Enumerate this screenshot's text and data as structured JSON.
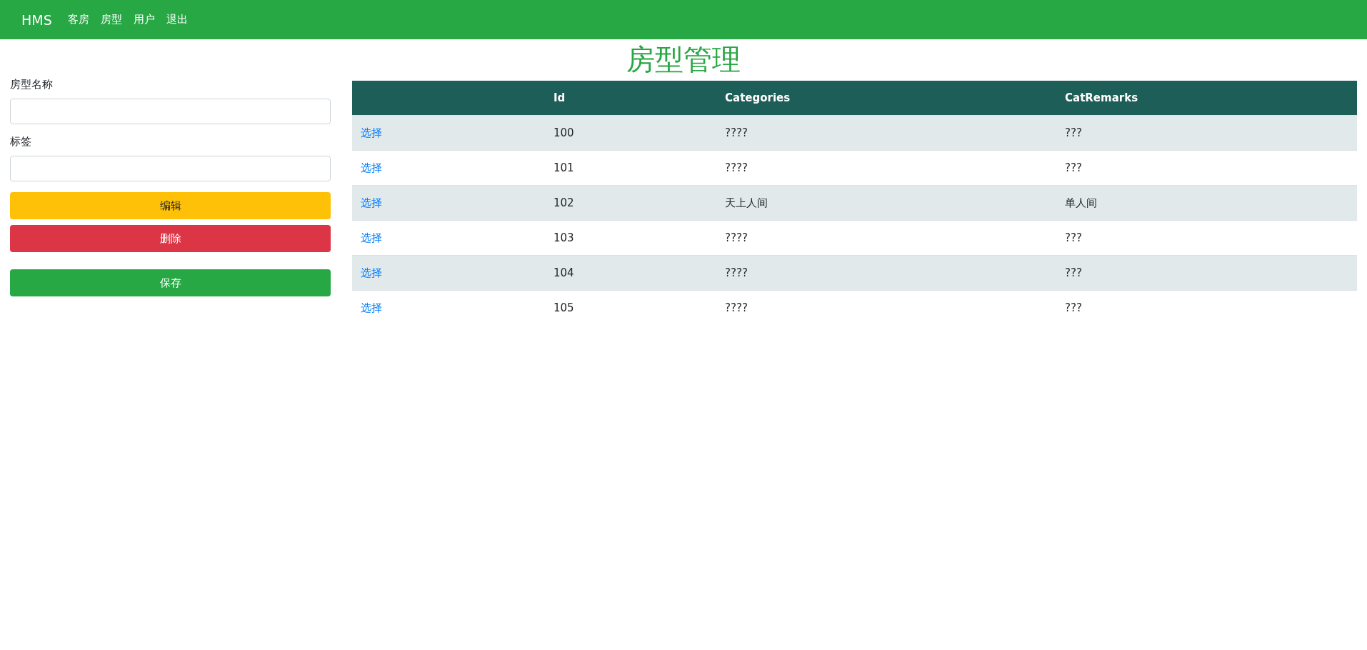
{
  "navbar": {
    "brand": "HMS",
    "links": [
      "客房",
      "房型",
      "用户",
      "退出"
    ]
  },
  "title": "房型管理",
  "form": {
    "fields": [
      {
        "label": "房型名称"
      },
      {
        "label": "标签"
      }
    ],
    "buttons": [
      {
        "label": "编辑",
        "kind": "warning"
      },
      {
        "label": "删除",
        "kind": "danger"
      },
      {
        "label": "保存",
        "kind": "success"
      }
    ]
  },
  "table": {
    "columns": [
      "",
      "Id",
      "Categories",
      "CatRemarks"
    ],
    "rows": [
      {
        "cells": [
          "选择",
          "100",
          "????",
          "???"
        ]
      },
      {
        "cells": [
          "选择",
          "101",
          "????",
          "???"
        ]
      },
      {
        "cells": [
          "选择",
          "102",
          "天上人间",
          "单人间"
        ]
      },
      {
        "cells": [
          "选择",
          "103",
          "????",
          "???"
        ]
      },
      {
        "cells": [
          "选择",
          "104",
          "????",
          "???"
        ]
      },
      {
        "cells": [
          "选择",
          "105",
          "????",
          "???"
        ]
      }
    ]
  }
}
